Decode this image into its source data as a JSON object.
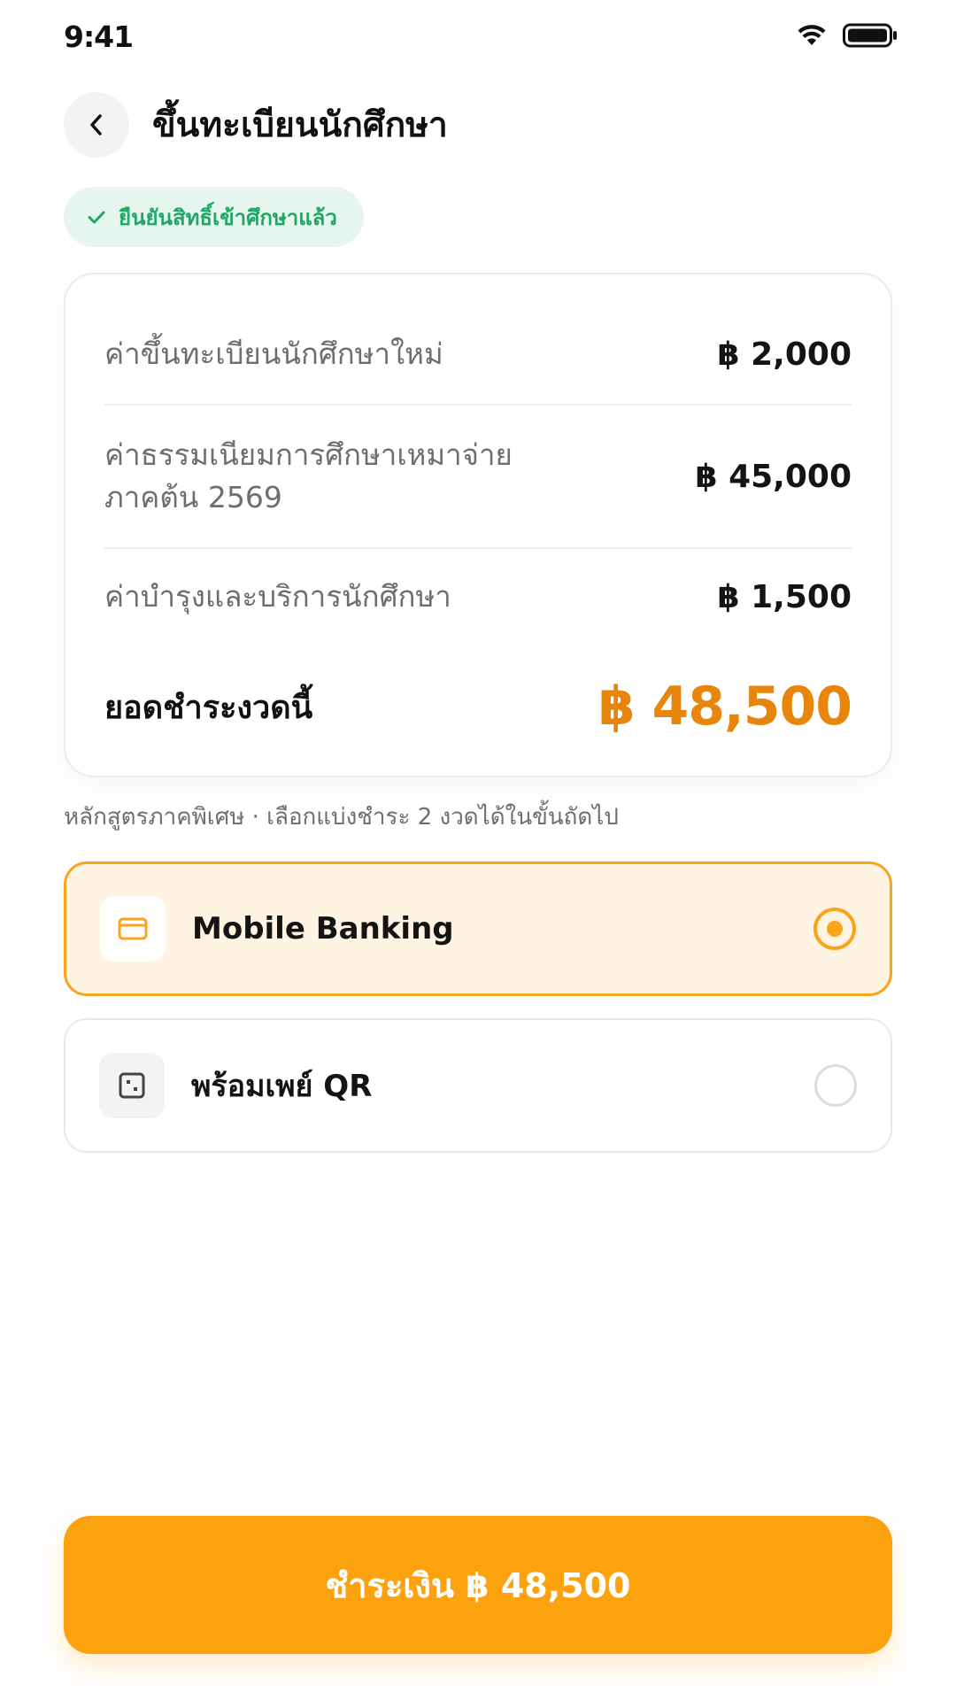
{
  "status": {
    "time": "9:41"
  },
  "header": {
    "title": "ขึ้นทะเบียนนักศึกษา"
  },
  "badge": {
    "text": "ยืนยันสิทธิ์เข้าศึกษาแล้ว"
  },
  "fees": {
    "items": [
      {
        "label": "ค่าขึ้นทะเบียนนักศึกษาใหม่",
        "amount": "฿ 2,000"
      },
      {
        "label_line1": "ค่าธรรมเนียมการศึกษาเหมาจ่าย",
        "label_line2": "ภาคต้น 2569",
        "amount": "฿ 45,000"
      },
      {
        "label": "ค่าบำรุงและบริการนักศึกษา",
        "amount": "฿ 1,500"
      }
    ],
    "total_label": "ยอดชำระงวดนี้",
    "total_amount": "฿ 48,500"
  },
  "note": "หลักสูตรภาคพิเศษ · เลือกแบ่งชำระ 2 งวดได้ในขั้นถัดไป",
  "payment_methods": [
    {
      "label": "Mobile Banking",
      "icon": "card-icon",
      "selected": true
    },
    {
      "label": "พร้อมเพย์ QR",
      "icon": "qr-icon",
      "selected": false
    }
  ],
  "pay_button": {
    "label": "ชำระเงิน ฿ 48,500"
  },
  "colors": {
    "accent": "#fda20f",
    "total": "#e8850d",
    "success": "#1fa864",
    "selected_bg": "#fff3e1"
  }
}
